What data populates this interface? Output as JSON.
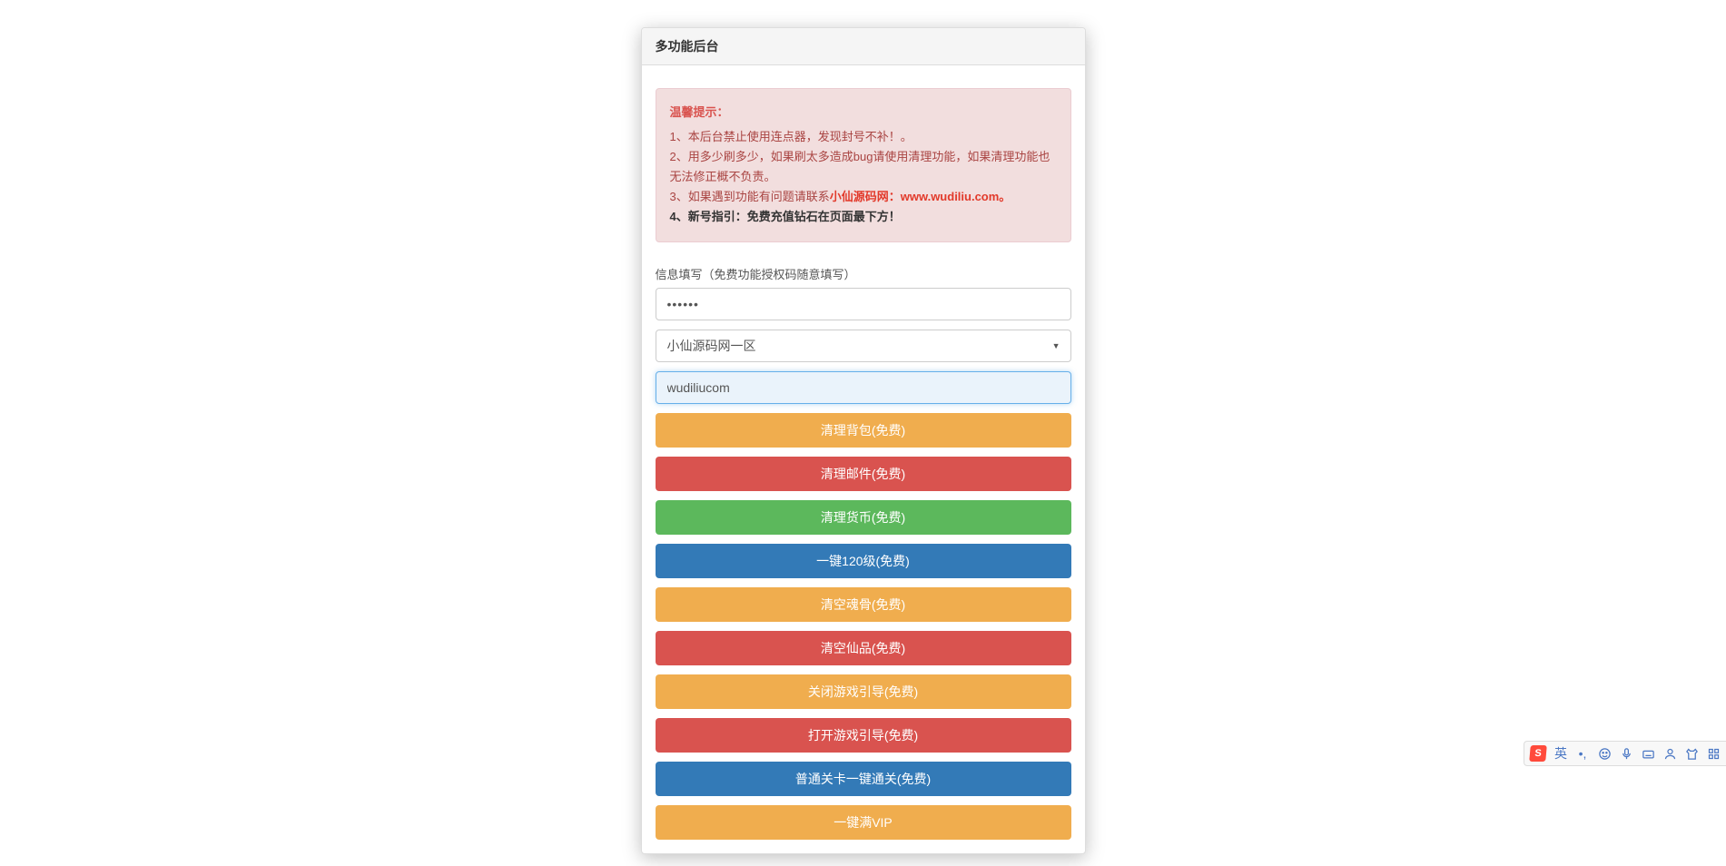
{
  "panel": {
    "title": "多功能后台"
  },
  "alert": {
    "title": "温馨提示：",
    "line1": "1、本后台禁止使用连点器，发现封号不补！。",
    "line2": "2、用多少刷多少，如果刷太多造成bug请使用清理功能，如果清理功能也无法修正概不负责。",
    "line3_prefix": "3、如果遇到功能有问题请联系",
    "line3_highlight": "小仙源码网：www.wudiliu.com。",
    "line4": "4、新号指引：免费充值钻石在页面最下方！"
  },
  "form": {
    "label": "信息填写（免费功能授权码随意填写）",
    "password_value": "••••••",
    "select_value": "小仙源码网一区",
    "text_value": "wudiliucom"
  },
  "buttons": [
    {
      "label": "清理背包(免费)",
      "style": "warning"
    },
    {
      "label": "清理邮件(免费)",
      "style": "danger"
    },
    {
      "label": "清理货币(免费)",
      "style": "success"
    },
    {
      "label": "一键120级(免费)",
      "style": "primary"
    },
    {
      "label": "清空魂骨(免费)",
      "style": "warning"
    },
    {
      "label": "清空仙品(免费)",
      "style": "danger"
    },
    {
      "label": "关闭游戏引导(免费)",
      "style": "warning"
    },
    {
      "label": "打开游戏引导(免费)",
      "style": "danger"
    },
    {
      "label": "普通关卡一键通关(免费)",
      "style": "primary"
    },
    {
      "label": "一键满VIP",
      "style": "warning"
    }
  ],
  "ime": {
    "logo": "S",
    "lang": "英"
  }
}
